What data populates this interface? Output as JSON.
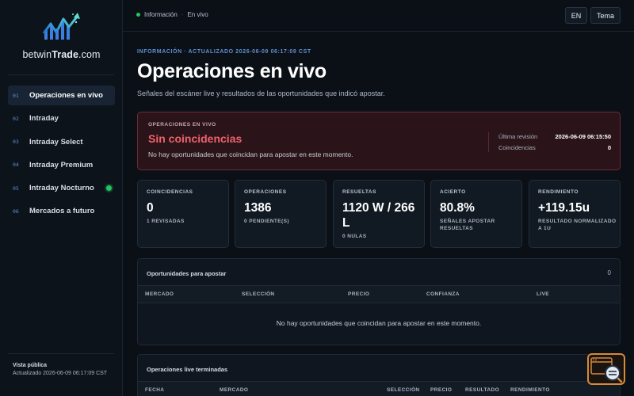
{
  "brand": {
    "prefix": "betwin",
    "bold": "Trade",
    "suffix": ".com"
  },
  "sidebar": {
    "items": [
      {
        "num": "01",
        "label": "Operaciones en vivo",
        "active": true
      },
      {
        "num": "02",
        "label": "Intraday"
      },
      {
        "num": "03",
        "label": "Intraday Select"
      },
      {
        "num": "04",
        "label": "Intraday Premium"
      },
      {
        "num": "05",
        "label": "Intraday Nocturno",
        "live": true
      },
      {
        "num": "06",
        "label": "Mercados a futuro"
      }
    ],
    "footer": {
      "view": "Vista pública",
      "updated": "Actualizado 2026-06-09 06:17:09 CST"
    }
  },
  "topbar": {
    "crumb1": "Información",
    "crumb_sep": "·",
    "crumb2": "En vivo",
    "lang_button": "EN",
    "theme_button": "Tema"
  },
  "header": {
    "kicker": "INFORMACIÓN · ACTUALIZADO 2026-06-09 06:17:09 CST",
    "title": "Operaciones en vivo",
    "subtitle": "Señales del escáner live y resultados de las oportunidades que indicó apostar."
  },
  "alert": {
    "kicker": "OPERACIONES EN VIVO",
    "title": "Sin coincidencias",
    "message": "No hay oportunidades que coincidan para apostar en este momento.",
    "last_review_label": "Última revisión",
    "last_review_value": "2026-06-09 06:15:50",
    "matches_label": "Coincidencias",
    "matches_value": "0"
  },
  "cards": [
    {
      "label": "COINCIDENCIAS",
      "value": "0",
      "sub": "1 REVISADAS"
    },
    {
      "label": "OPERACIONES",
      "value": "1386",
      "sub": "0 PENDIENTE(S)"
    },
    {
      "label": "RESUELTAS",
      "value": "1120 W / 266 L",
      "sub": "0 NULAS"
    },
    {
      "label": "ACIERTO",
      "value": "80.8%",
      "sub": "SEÑALES APOSTAR RESUELTAS"
    },
    {
      "label": "RENDIMIENTO",
      "value": "+119.15u",
      "sub": "RESULTADO NORMALIZADO A 1U"
    }
  ],
  "opportunities": {
    "title": "Oportunidades para apostar",
    "count": "0",
    "columns": [
      "MERCADO",
      "SELECCIÓN",
      "PRECIO",
      "CONFIANZA",
      "LIVE"
    ],
    "empty": "No hay oportunidades que coincidan para apostar en este momento."
  },
  "finished": {
    "title": "Operaciones live terminadas",
    "columns": [
      "FECHA",
      "MERCADO",
      "SELECCIÓN",
      "PRECIO",
      "RESULTADO",
      "RENDIMIENTO"
    ]
  },
  "colors": {
    "accent": "#5d8fd0",
    "alert": "#f0616d",
    "live": "#22c55e",
    "fab": "#d68a3a"
  }
}
